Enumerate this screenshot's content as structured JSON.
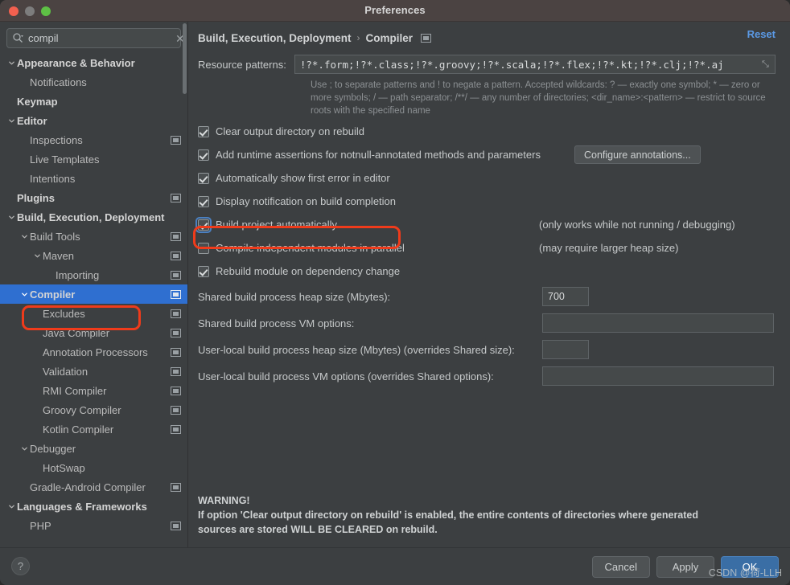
{
  "window": {
    "title": "Preferences",
    "traffic_lights": [
      "close-button",
      "minimize-button",
      "zoom-button"
    ]
  },
  "sidebar": {
    "search": {
      "value": "compil",
      "placeholder": "",
      "clear_label": "✕"
    },
    "items": [
      {
        "label": "Appearance & Behavior",
        "indent": 0,
        "arrow": "down",
        "bold": true,
        "module": false,
        "selected": false
      },
      {
        "label": "Notifications",
        "indent": 1,
        "arrow": "none",
        "bold": false,
        "module": false,
        "selected": false
      },
      {
        "label": "Keymap",
        "indent": 0,
        "arrow": "none",
        "bold": true,
        "module": false,
        "selected": false
      },
      {
        "label": "Editor",
        "indent": 0,
        "arrow": "down",
        "bold": true,
        "module": false,
        "selected": false
      },
      {
        "label": "Inspections",
        "indent": 1,
        "arrow": "none",
        "bold": false,
        "module": true,
        "selected": false
      },
      {
        "label": "Live Templates",
        "indent": 1,
        "arrow": "none",
        "bold": false,
        "module": false,
        "selected": false
      },
      {
        "label": "Intentions",
        "indent": 1,
        "arrow": "none",
        "bold": false,
        "module": false,
        "selected": false
      },
      {
        "label": "Plugins",
        "indent": 0,
        "arrow": "none",
        "bold": true,
        "module": true,
        "selected": false
      },
      {
        "label": "Build, Execution, Deployment",
        "indent": 0,
        "arrow": "down",
        "bold": true,
        "module": false,
        "selected": false
      },
      {
        "label": "Build Tools",
        "indent": 1,
        "arrow": "down",
        "bold": false,
        "module": true,
        "selected": false
      },
      {
        "label": "Maven",
        "indent": 2,
        "arrow": "down",
        "bold": false,
        "module": true,
        "selected": false
      },
      {
        "label": "Importing",
        "indent": 3,
        "arrow": "none",
        "bold": false,
        "module": true,
        "selected": false
      },
      {
        "label": "Compiler",
        "indent": 1,
        "arrow": "down",
        "bold": true,
        "module": true,
        "selected": true
      },
      {
        "label": "Excludes",
        "indent": 2,
        "arrow": "none",
        "bold": false,
        "module": true,
        "selected": false
      },
      {
        "label": "Java Compiler",
        "indent": 2,
        "arrow": "none",
        "bold": false,
        "module": true,
        "selected": false
      },
      {
        "label": "Annotation Processors",
        "indent": 2,
        "arrow": "none",
        "bold": false,
        "module": true,
        "selected": false
      },
      {
        "label": "Validation",
        "indent": 2,
        "arrow": "none",
        "bold": false,
        "module": true,
        "selected": false
      },
      {
        "label": "RMI Compiler",
        "indent": 2,
        "arrow": "none",
        "bold": false,
        "module": true,
        "selected": false
      },
      {
        "label": "Groovy Compiler",
        "indent": 2,
        "arrow": "none",
        "bold": false,
        "module": true,
        "selected": false
      },
      {
        "label": "Kotlin Compiler",
        "indent": 2,
        "arrow": "none",
        "bold": false,
        "module": true,
        "selected": false
      },
      {
        "label": "Debugger",
        "indent": 1,
        "arrow": "down",
        "bold": false,
        "module": false,
        "selected": false
      },
      {
        "label": "HotSwap",
        "indent": 2,
        "arrow": "none",
        "bold": false,
        "module": false,
        "selected": false
      },
      {
        "label": "Gradle-Android Compiler",
        "indent": 1,
        "arrow": "none",
        "bold": false,
        "module": true,
        "selected": false
      },
      {
        "label": "Languages & Frameworks",
        "indent": 0,
        "arrow": "down",
        "bold": true,
        "module": false,
        "selected": false
      },
      {
        "label": "PHP",
        "indent": 1,
        "arrow": "none",
        "bold": false,
        "module": true,
        "selected": false
      }
    ]
  },
  "main": {
    "breadcrumb": {
      "parent": "Build, Execution, Deployment",
      "separator": "›",
      "current": "Compiler"
    },
    "reset_label": "Reset",
    "resource_patterns": {
      "label": "Resource patterns:",
      "value": "!?*.form;!?*.class;!?*.groovy;!?*.scala;!?*.flex;!?*.kt;!?*.clj;!?*.aj",
      "expand_icon": "⤡"
    },
    "hint": "Use ; to separate patterns and ! to negate a pattern. Accepted wildcards: ? — exactly one symbol; * — zero or more symbols; / — path separator; /**/ — any number of directories; <dir_name>:<pattern> — restrict to source roots with the specified name",
    "checkboxes": [
      {
        "label": "Clear output directory on rebuild",
        "checked": true,
        "focused": false,
        "note": "",
        "button": ""
      },
      {
        "label": "Add runtime assertions for notnull-annotated methods and parameters",
        "checked": true,
        "focused": false,
        "note": "",
        "button": "Configure annotations..."
      },
      {
        "label": "Automatically show first error in editor",
        "checked": true,
        "focused": false,
        "note": "",
        "button": ""
      },
      {
        "label": "Display notification on build completion",
        "checked": true,
        "focused": false,
        "note": "",
        "button": ""
      },
      {
        "label": "Build project automatically",
        "checked": true,
        "focused": true,
        "note": "(only works while not running / debugging)",
        "button": ""
      },
      {
        "label": "Compile independent modules in parallel",
        "checked": false,
        "focused": false,
        "note": "(may require larger heap size)",
        "button": ""
      },
      {
        "label": "Rebuild module on dependency change",
        "checked": true,
        "focused": false,
        "note": "",
        "button": ""
      }
    ],
    "fields": [
      {
        "label": "Shared build process heap size (Mbytes):",
        "value": "700",
        "size": "small"
      },
      {
        "label": "Shared build process VM options:",
        "value": "",
        "size": "wide"
      },
      {
        "label": "User-local build process heap size (Mbytes) (overrides Shared size):",
        "value": "",
        "size": "small"
      },
      {
        "label": "User-local build process VM options (overrides Shared options):",
        "value": "",
        "size": "wide"
      }
    ],
    "warning": {
      "title": "WARNING!",
      "line1": "If option 'Clear output directory on rebuild' is enabled, the entire contents of directories where generated",
      "line2": "sources are stored WILL BE CLEARED on rebuild."
    }
  },
  "footer": {
    "help_label": "?",
    "cancel_label": "Cancel",
    "apply_label": "Apply",
    "ok_label": "OK"
  },
  "watermark": "CSDN @荷-LLH",
  "colors": {
    "accent_selection": "#2f6fd0",
    "link": "#5b9ae6",
    "primary_button": "#3a6ea5",
    "annotation": "#ef3b1b",
    "panel_bg": "#3c3f41",
    "titlebar_bg": "#4b4342"
  }
}
